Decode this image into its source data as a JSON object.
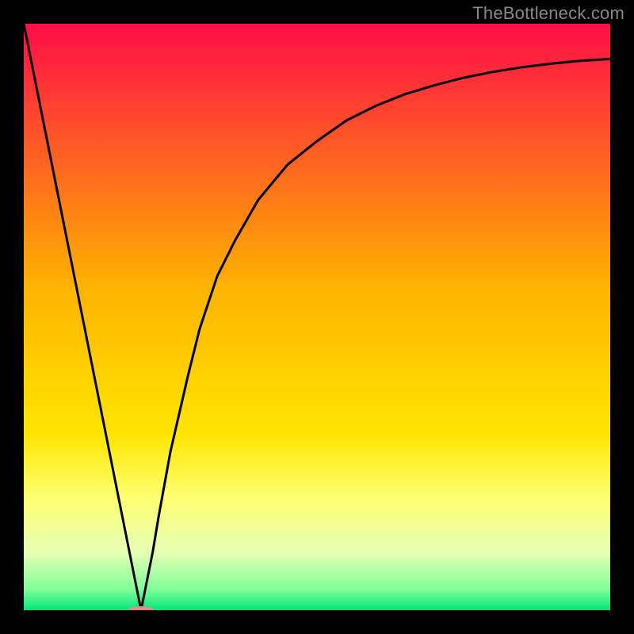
{
  "attribution": "TheBottleneck.com",
  "chart_data": {
    "type": "line",
    "title": "",
    "xlabel": "",
    "ylabel": "",
    "xlim": [
      0,
      100
    ],
    "ylim": [
      0,
      100
    ],
    "gradient_stops": [
      {
        "offset": 0.0,
        "color": "#ff0d46"
      },
      {
        "offset": 0.45,
        "color": "#ffb300"
      },
      {
        "offset": 0.7,
        "color": "#ffe500"
      },
      {
        "offset": 0.8,
        "color": "#feff6a"
      },
      {
        "offset": 0.9,
        "color": "#e8ffb4"
      },
      {
        "offset": 0.965,
        "color": "#7fff9a"
      },
      {
        "offset": 1.0,
        "color": "#00e676"
      }
    ],
    "series": [
      {
        "name": "bottleneck-curve",
        "x": [
          0,
          5,
          10,
          15,
          18,
          19,
          20,
          21,
          22,
          23,
          25,
          28,
          30,
          33,
          36,
          40,
          45,
          50,
          55,
          60,
          65,
          70,
          75,
          80,
          85,
          90,
          95,
          100
        ],
        "y": [
          100,
          75,
          50,
          25,
          10,
          5,
          0,
          5,
          10,
          16,
          27,
          40,
          48,
          57,
          63,
          70,
          76,
          80,
          83.5,
          86,
          88,
          89.5,
          90.8,
          91.8,
          92.6,
          93.2,
          93.7,
          94.0
        ]
      }
    ],
    "marker": {
      "x": 20,
      "y": 0,
      "rx": 2.2,
      "ry": 0.7,
      "color": "#e08a8a"
    }
  }
}
